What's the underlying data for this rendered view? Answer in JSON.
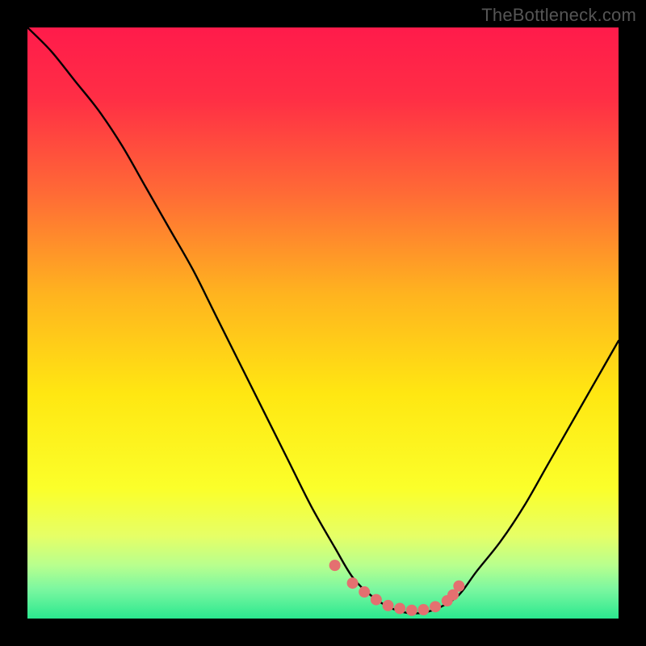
{
  "watermark": "TheBottleneck.com",
  "colors": {
    "curve_black": "#000000",
    "dot_pink": "#e47070",
    "gradient_stops": [
      {
        "pct": 0,
        "color": "#ff1b4b"
      },
      {
        "pct": 12,
        "color": "#ff2e45"
      },
      {
        "pct": 28,
        "color": "#ff6a36"
      },
      {
        "pct": 45,
        "color": "#ffb31f"
      },
      {
        "pct": 62,
        "color": "#ffe712"
      },
      {
        "pct": 78,
        "color": "#fbff2a"
      },
      {
        "pct": 86,
        "color": "#e6ff66"
      },
      {
        "pct": 91,
        "color": "#b8ff8e"
      },
      {
        "pct": 95,
        "color": "#7cf7a0"
      },
      {
        "pct": 100,
        "color": "#2be88f"
      }
    ]
  },
  "chart_data": {
    "type": "line",
    "title": "",
    "xlabel": "",
    "ylabel": "",
    "xlim": [
      0,
      100
    ],
    "ylim": [
      0,
      100
    ],
    "series": [
      {
        "name": "bottleneck-curve",
        "x": [
          0,
          4,
          8,
          12,
          16,
          20,
          24,
          28,
          32,
          36,
          40,
          44,
          48,
          52,
          55,
          58,
          61,
          64,
          67,
          70,
          73,
          76,
          80,
          84,
          88,
          92,
          96,
          100
        ],
        "y": [
          100,
          96,
          91,
          86,
          80,
          73,
          66,
          59,
          51,
          43,
          35,
          27,
          19,
          12,
          7,
          4,
          2,
          1,
          1,
          2,
          4,
          8,
          13,
          19,
          26,
          33,
          40,
          47
        ]
      }
    ],
    "highlight_points": {
      "name": "recommended-range",
      "x": [
        52,
        55,
        57,
        59,
        61,
        63,
        65,
        67,
        69,
        71,
        72,
        73
      ],
      "y": [
        9,
        6,
        4.5,
        3.2,
        2.2,
        1.7,
        1.4,
        1.5,
        2.0,
        3.0,
        4.0,
        5.5
      ]
    }
  }
}
